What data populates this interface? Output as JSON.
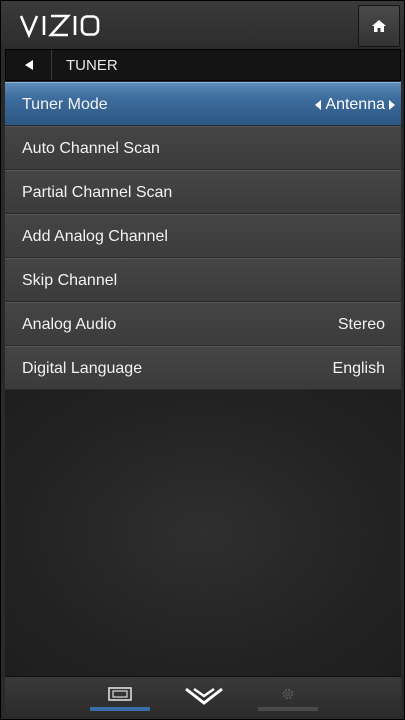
{
  "brand": {
    "logo_text": "VIZIO"
  },
  "header": {
    "home_icon": "home-icon"
  },
  "titlebar": {
    "back_icon": "triangle-left-icon",
    "title": "TUNER"
  },
  "menu": {
    "items": [
      {
        "label": "Tuner Mode",
        "value": "Antenna",
        "selected": true
      },
      {
        "label": "Auto Channel Scan",
        "value": ""
      },
      {
        "label": "Partial Channel Scan",
        "value": ""
      },
      {
        "label": "Add Analog Channel",
        "value": ""
      },
      {
        "label": "Skip Channel",
        "value": ""
      },
      {
        "label": "Analog Audio",
        "value": "Stereo"
      },
      {
        "label": "Digital Language",
        "value": "English"
      }
    ]
  },
  "bottom_nav": {
    "items": [
      {
        "icon": "screen-icon",
        "active": true
      },
      {
        "icon": "vizio-chevron-icon",
        "active": false
      },
      {
        "icon": "gear-icon",
        "active": false,
        "disabled": true
      }
    ]
  },
  "colors": {
    "selected_top": "#5d8cb8",
    "selected_bottom": "#2c5683",
    "active_underline": "#3b6ea8",
    "inactive_underline": "#4a4a4a"
  }
}
